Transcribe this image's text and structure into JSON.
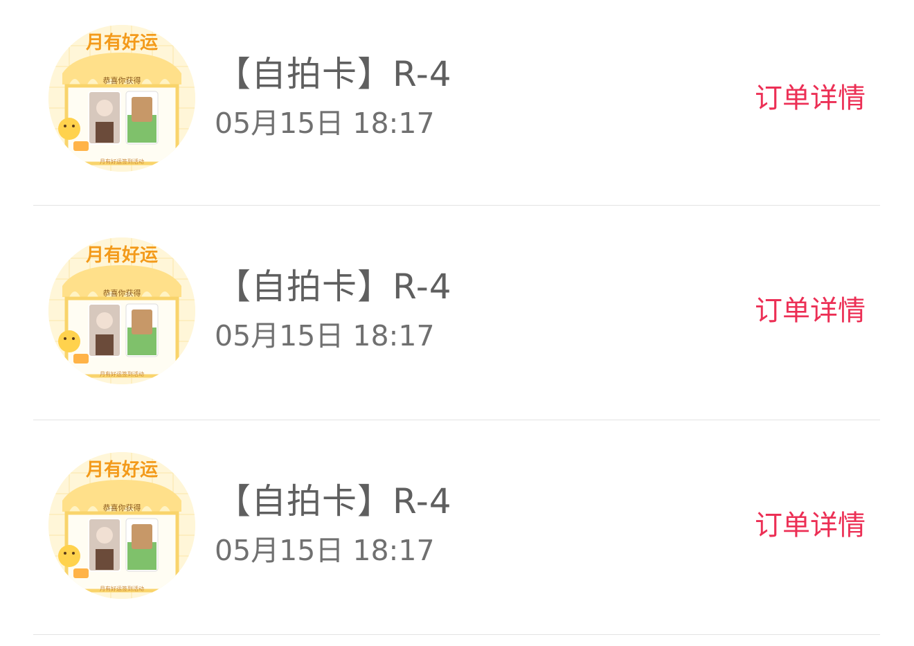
{
  "orders": [
    {
      "title": "【自拍卡】R-4",
      "time": "05月15日 18:17",
      "detail_label": "订单详情",
      "thumbnail": {
        "icon": "photocard-thumbnail",
        "banner_text": "月有好运",
        "sub_text": "恭喜你获得",
        "footer_text": "月有好运签到活动"
      }
    },
    {
      "title": "【自拍卡】R-4",
      "time": "05月15日 18:17",
      "detail_label": "订单详情",
      "thumbnail": {
        "icon": "photocard-thumbnail",
        "banner_text": "月有好运",
        "sub_text": "恭喜你获得",
        "footer_text": "月有好运签到活动"
      }
    },
    {
      "title": "【自拍卡】R-4",
      "time": "05月15日 18:17",
      "detail_label": "订单详情",
      "thumbnail": {
        "icon": "photocard-thumbnail",
        "banner_text": "月有好运",
        "sub_text": "恭喜你获得",
        "footer_text": "月有好运签到活动"
      }
    }
  ],
  "colors": {
    "accent": "#ec2f55",
    "title_text": "#5f5f5f",
    "time_text": "#707070",
    "divider": "#e3e3e3",
    "thumb_bg": "#fff6d8"
  }
}
